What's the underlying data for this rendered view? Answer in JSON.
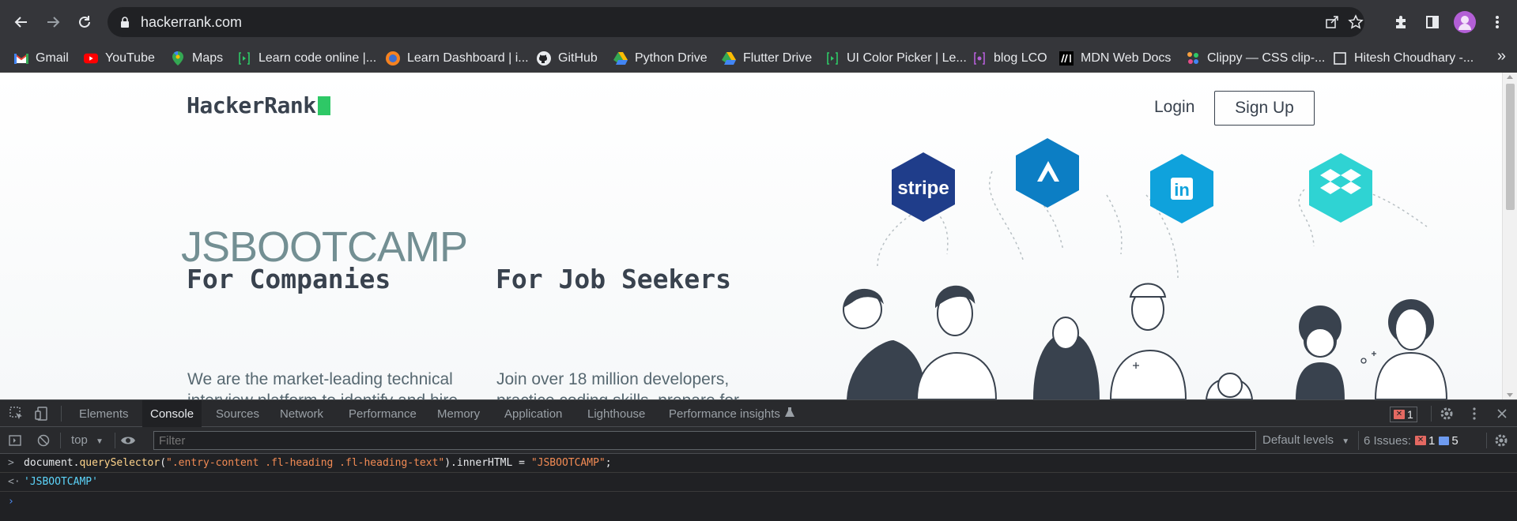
{
  "browser": {
    "url": "hackerrank.com",
    "bookmarks": [
      {
        "label": "Gmail",
        "icon": "gmail-icon"
      },
      {
        "label": "YouTube",
        "icon": "youtube-icon"
      },
      {
        "label": "Maps",
        "icon": "maps-icon"
      },
      {
        "label": "Learn code online |...",
        "icon": "learn-code-icon"
      },
      {
        "label": "Learn Dashboard | i...",
        "icon": "learn-dashboard-icon"
      },
      {
        "label": "GitHub",
        "icon": "github-icon"
      },
      {
        "label": "Python Drive",
        "icon": "drive-icon"
      },
      {
        "label": "Flutter Drive",
        "icon": "drive-icon"
      },
      {
        "label": "UI Color Picker | Le...",
        "icon": "color-picker-icon"
      },
      {
        "label": "blog LCO",
        "icon": "blog-icon"
      },
      {
        "label": "MDN Web Docs",
        "icon": "mdn-icon"
      },
      {
        "label": "Clippy — CSS clip-...",
        "icon": "clippy-icon"
      },
      {
        "label": "Hitesh Choudhary -...",
        "icon": "page-icon"
      }
    ],
    "more_label": "»"
  },
  "page": {
    "logo_text": "HackerRank",
    "login_label": "Login",
    "signup_label": "Sign Up",
    "hero_title": "JSBOOTCAMP",
    "companies_heading": "For Companies",
    "companies_text": "We are the market-leading technical",
    "companies_text_2": "interview platform to identify and hire",
    "seekers_heading": "For Job Seekers",
    "seekers_text": "Join over 18 million developers,",
    "seekers_text_2": "practice coding skills, prepare for",
    "brand_logos": [
      "stripe",
      "atlassian",
      "in",
      "dropbox"
    ]
  },
  "devtools": {
    "tabs": [
      "Elements",
      "Console",
      "Sources",
      "Network",
      "Performance",
      "Memory",
      "Application",
      "Lighthouse",
      "Performance insights"
    ],
    "active_tab": "Console",
    "error_count": "1",
    "context": "top",
    "filter_placeholder": "Filter",
    "levels_label": "Default levels",
    "issues_label": "6 Issues:",
    "issues_errors": "1",
    "issues_messages": "5",
    "console": {
      "cmd_obj": "document.",
      "cmd_fn": "querySelector",
      "cmd_open": "(",
      "cmd_selector": "\".entry-content .fl-heading .fl-heading-text\"",
      "cmd_mid": ").innerHTML = ",
      "cmd_value": "\"JSBOOTCAMP\"",
      "cmd_end": ";",
      "result": "'JSBOOTCAMP'"
    }
  },
  "colors": {
    "brand_green": "#2ec866",
    "stripe_blue": "#1f3d8a",
    "atlassian_blue": "#0c7ec4",
    "linkedin_blue": "#0fa2dc",
    "dropbox_teal": "#2fd3d3"
  }
}
